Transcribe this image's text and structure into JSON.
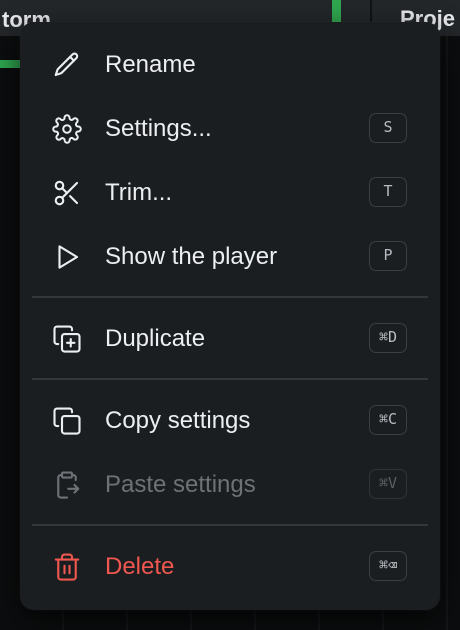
{
  "background": {
    "left_tab": "torm",
    "right_tab": "Proje"
  },
  "menu": {
    "items": [
      {
        "label": "Rename",
        "icon": "pencil-icon",
        "shortcut": ""
      },
      {
        "label": "Settings...",
        "icon": "gear-icon",
        "shortcut": "S"
      },
      {
        "label": "Trim...",
        "icon": "scissors-icon",
        "shortcut": "T"
      },
      {
        "label": "Show the player",
        "icon": "play-icon",
        "shortcut": "P"
      },
      {
        "label": "Duplicate",
        "icon": "duplicate-icon",
        "shortcut": "⌘D"
      },
      {
        "label": "Copy settings",
        "icon": "copy-icon",
        "shortcut": "⌘C"
      },
      {
        "label": "Paste settings",
        "icon": "clipboard-paste-icon",
        "shortcut": "⌘V",
        "disabled": true
      },
      {
        "label": "Delete",
        "icon": "trash-icon",
        "shortcut": "⌘⌫",
        "danger": true
      }
    ]
  },
  "colors": {
    "menu_bg": "#1b1e21",
    "text": "#eceef0",
    "disabled_text": "#6d7276",
    "danger": "#f0574f",
    "accent_green": "#2fa84f"
  }
}
